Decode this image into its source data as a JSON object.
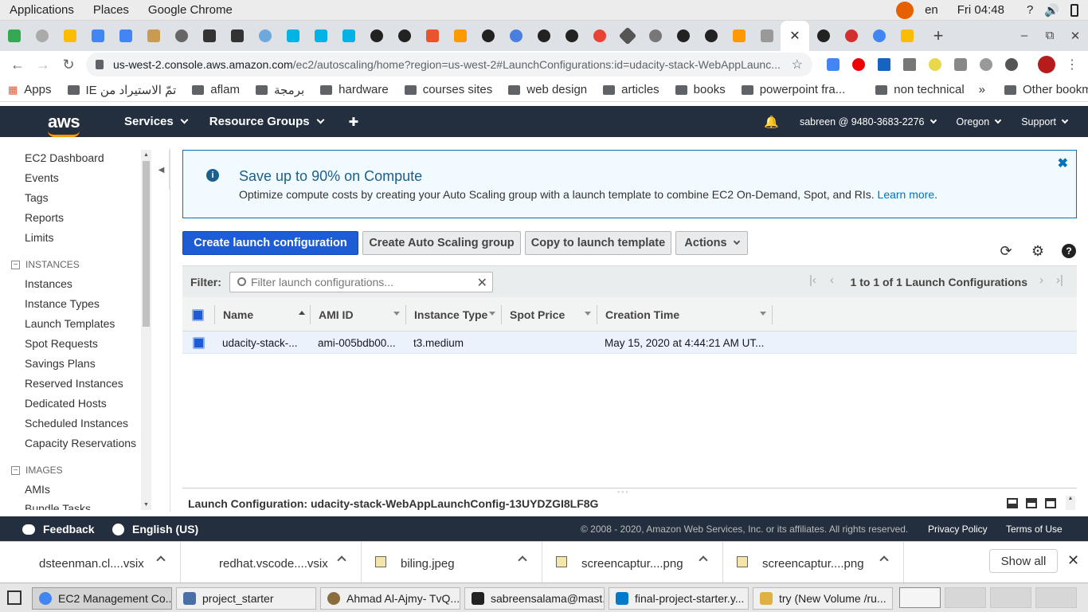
{
  "gnome": {
    "menus": [
      "Applications",
      "Places",
      "Google Chrome"
    ],
    "lang": "en",
    "clock": "Fri 04:48"
  },
  "browser": {
    "url_host": "us-west-2.console.aws.amazon.com",
    "url_path": "/ec2/autoscaling/home?region=us-west-2#LaunchConfigurations:id=udacity-stack-WebAppLaunc...",
    "bookmarks": [
      "Apps",
      "IE تمّ الاستيراد من",
      "aflam",
      "برمجة",
      "hardware",
      "courses sites",
      "web design",
      "articles",
      "books",
      "powerpoint fra...",
      "non technical",
      "Other bookmarks"
    ]
  },
  "aws_nav": {
    "logo": "aws",
    "services": "Services",
    "resource_groups": "Resource Groups",
    "account": "sabreen @ 9480-3683-2276",
    "region": "Oregon",
    "support": "Support"
  },
  "sidebar": {
    "top_items": [
      "EC2 Dashboard",
      "Events",
      "Tags",
      "Reports",
      "Limits"
    ],
    "instances_header": "INSTANCES",
    "instances_items": [
      "Instances",
      "Instance Types",
      "Launch Templates",
      "Spot Requests",
      "Savings Plans",
      "Reserved Instances",
      "Dedicated Hosts",
      "Scheduled Instances",
      "Capacity Reservations"
    ],
    "images_header": "IMAGES",
    "images_items": [
      "AMIs",
      "Bundle Tasks"
    ]
  },
  "banner": {
    "title": "Save up to 90% on Compute",
    "description": "Optimize compute costs by creating your Auto Scaling group with a launch template to combine EC2 On-Demand, Spot, and RIs.",
    "link": "Learn more",
    "link_suffix": "."
  },
  "actions": {
    "create_launch_config": "Create launch configuration",
    "create_asg": "Create Auto Scaling group",
    "copy_template": "Copy to launch template",
    "actions": "Actions"
  },
  "filter": {
    "label": "Filter:",
    "placeholder": "Filter launch configurations...",
    "pager": "1 to 1 of 1 Launch Configurations"
  },
  "table": {
    "columns": [
      "Name",
      "AMI ID",
      "Instance Type",
      "Spot Price",
      "Creation Time"
    ],
    "rows": [
      {
        "name": "udacity-stack-...",
        "ami": "ami-005bdb00...",
        "type": "t3.medium",
        "spot": "",
        "created": "May 15, 2020 at 4:44:21 AM UT..."
      }
    ]
  },
  "detail": {
    "title": "Launch Configuration: udacity-stack-WebAppLaunchConfig-13UYDZGI8LF8G"
  },
  "footer": {
    "feedback": "Feedback",
    "language": "English (US)",
    "copyright": "© 2008 - 2020, Amazon Web Services, Inc. or its affiliates. All rights reserved.",
    "privacy": "Privacy Policy",
    "terms": "Terms of Use"
  },
  "downloads": {
    "items": [
      "dsteenman.cl....vsix",
      "redhat.vscode....vsix",
      "biling.jpeg",
      "screencaptur....png",
      "screencaptur....png"
    ],
    "show_all": "Show all"
  },
  "taskbar": {
    "tasks": [
      "EC2 Management Co...",
      "project_starter",
      "Ahmad Al-Ajmy- TvQ...",
      "sabreensalama@mast...",
      "final-project-starter.y...",
      "try (New Volume /ru..."
    ]
  }
}
